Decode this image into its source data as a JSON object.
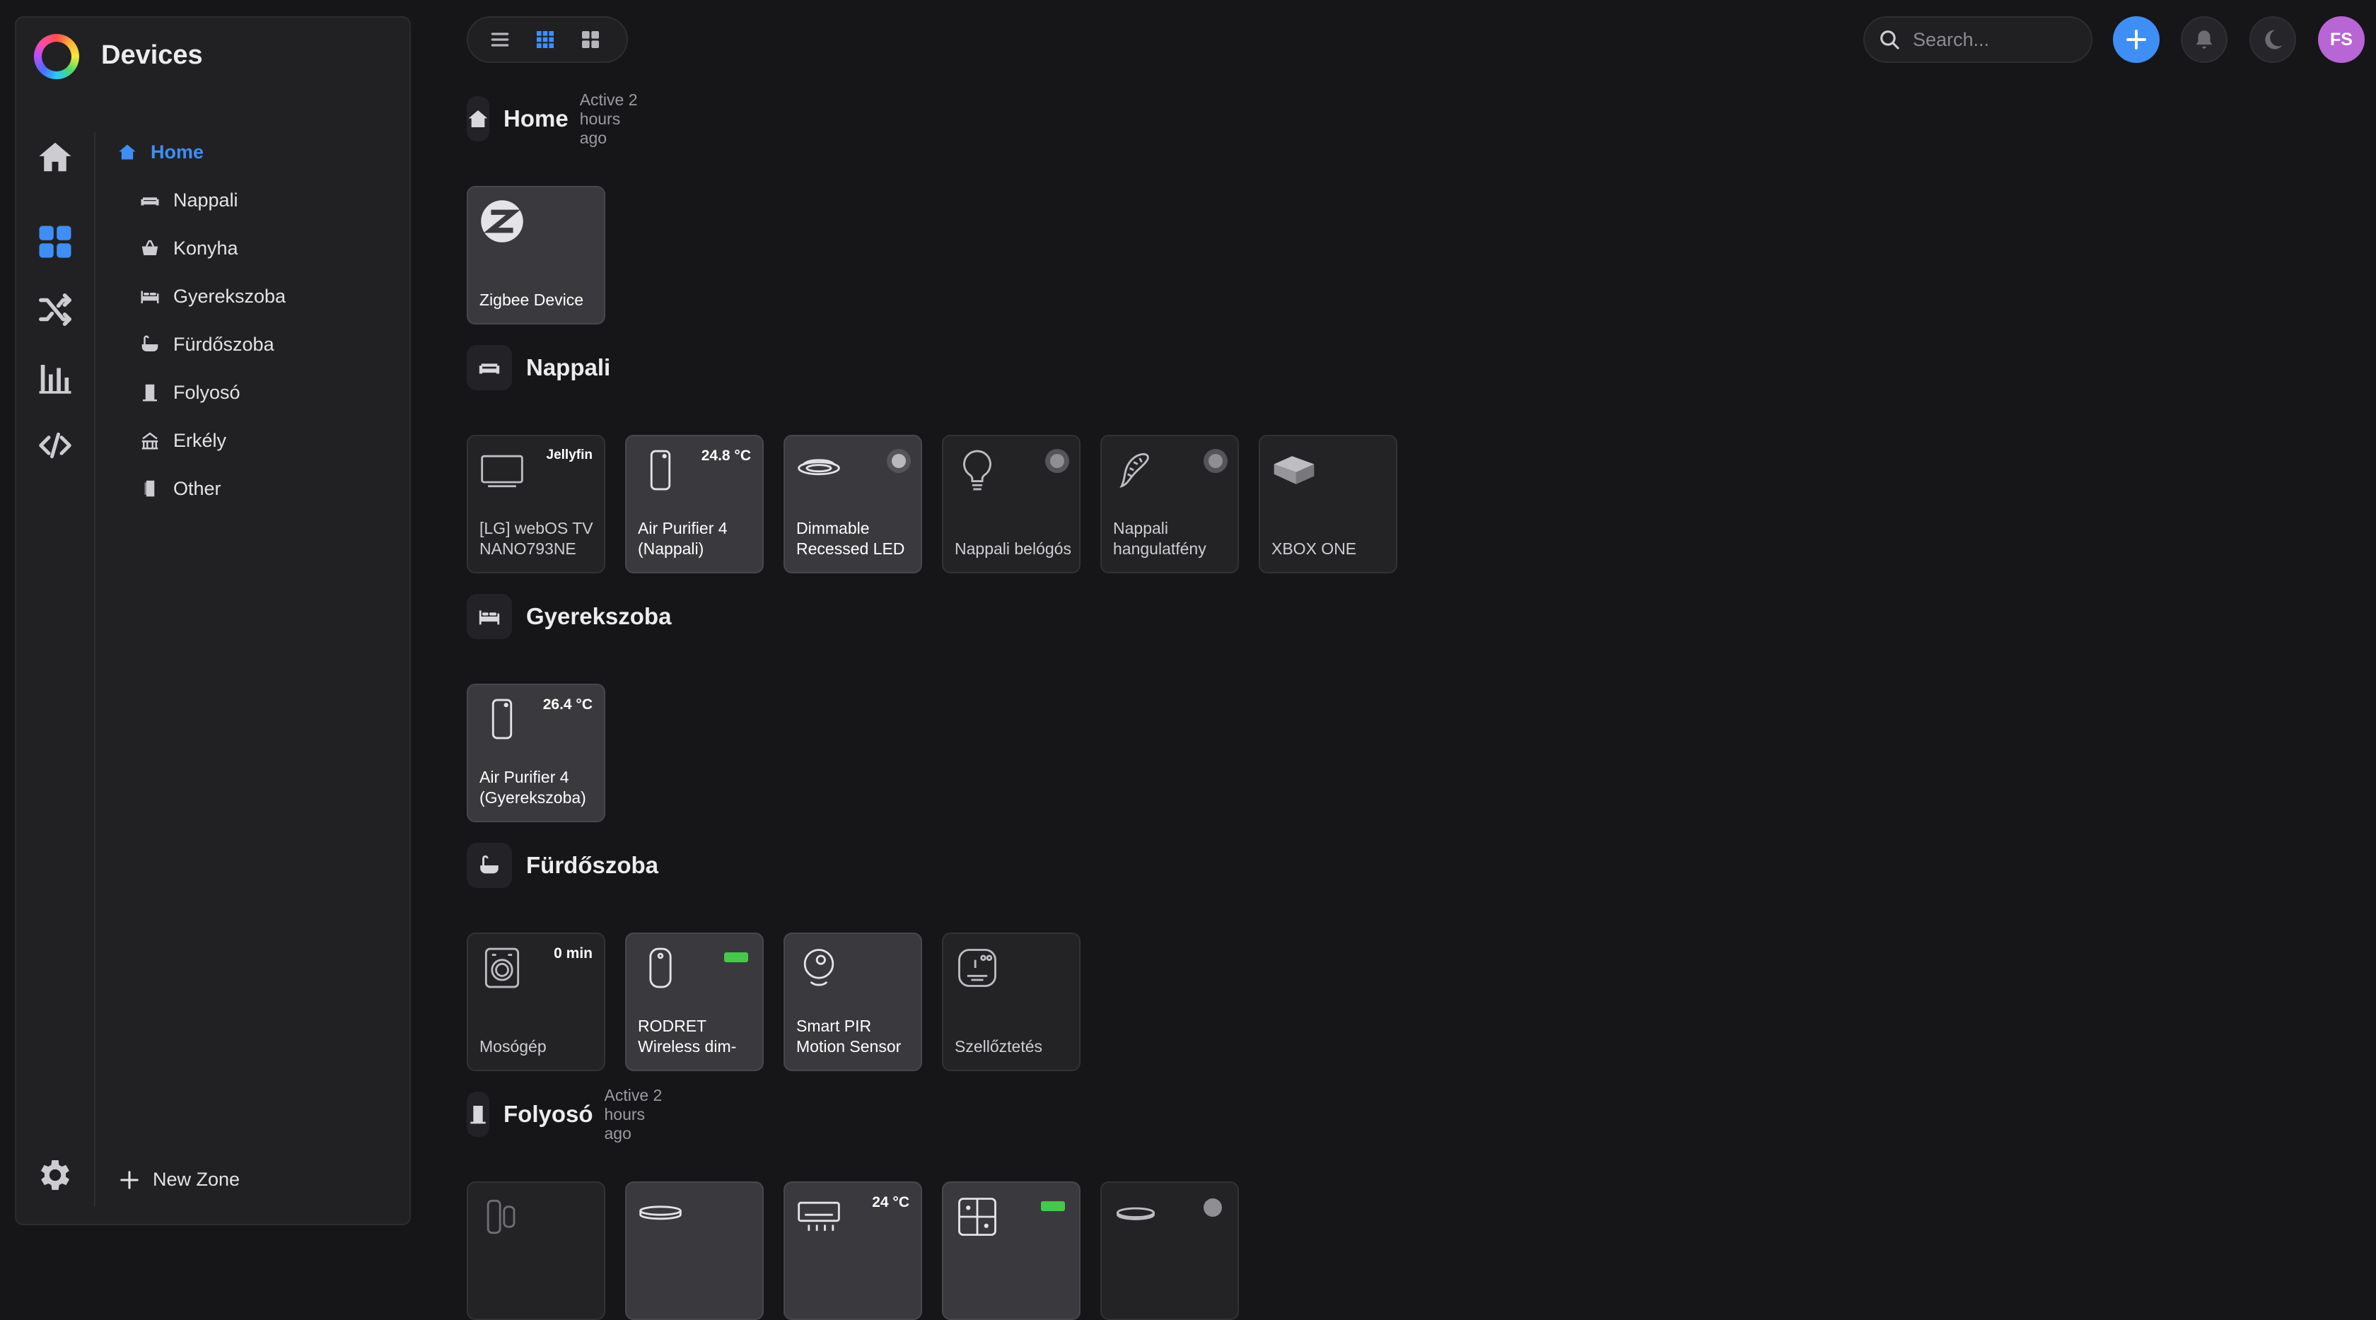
{
  "app": {
    "title": "Devices"
  },
  "sidebar": {
    "zones": [
      {
        "label": "Home",
        "icon": "home-icon",
        "active": true
      },
      {
        "label": "Nappali",
        "icon": "sofa-icon"
      },
      {
        "label": "Konyha",
        "icon": "basket-icon"
      },
      {
        "label": "Gyerekszoba",
        "icon": "bed-icon"
      },
      {
        "label": "Fürdőszoba",
        "icon": "bathtub-icon"
      },
      {
        "label": "Folyosó",
        "icon": "door-icon"
      },
      {
        "label": "Erkély",
        "icon": "balcony-icon"
      },
      {
        "label": "Other",
        "icon": "door-open-icon"
      }
    ],
    "new_zone_label": "New Zone"
  },
  "search": {
    "placeholder": "Search..."
  },
  "user": {
    "initials": "FS"
  },
  "colors": {
    "accent": "#3f8ef5",
    "avatar": "#b865d6",
    "battery": "#46c84a"
  },
  "zones": [
    {
      "title": "Home",
      "subtitle": "Active 2 hours ago",
      "icon": "home-icon",
      "devices": [
        {
          "label": "Zigbee Device",
          "icon": "zigbee-icon",
          "on": true
        }
      ]
    },
    {
      "title": "Nappali",
      "subtitle": "",
      "icon": "sofa-icon",
      "devices": [
        {
          "label": "[LG] webOS TV NANO793NE",
          "icon": "tv-icon",
          "status": "Jellyfin"
        },
        {
          "label": "Air Purifier 4 (Nappali)",
          "icon": "air-purifier-icon",
          "status": "24.8 °C",
          "on": true
        },
        {
          "label": "Dimmable Recessed LED",
          "icon": "recessed-light-icon",
          "on": true,
          "indicator": "toggle-on"
        },
        {
          "label": "Nappali belógós",
          "icon": "bulb-icon",
          "indicator": "toggle-off"
        },
        {
          "label": "Nappali hangulatfény",
          "icon": "led-strip-icon",
          "indicator": "toggle-off"
        },
        {
          "label": "XBOX ONE",
          "icon": "console-icon"
        }
      ]
    },
    {
      "title": "Gyerekszoba",
      "subtitle": "",
      "icon": "bed-icon",
      "devices": [
        {
          "label": "Air Purifier 4 (Gyerekszoba)",
          "icon": "air-purifier-icon",
          "status": "26.4 °C",
          "on": true
        }
      ]
    },
    {
      "title": "Fürdőszoba",
      "subtitle": "",
      "icon": "bathtub-icon",
      "devices": [
        {
          "label": "Mosógép",
          "icon": "washing-machine-icon",
          "status": "0 min"
        },
        {
          "label": "RODRET Wireless dim-",
          "icon": "remote-icon",
          "on": true,
          "indicator": "battery"
        },
        {
          "label": "Smart PIR Motion Sensor",
          "icon": "motion-sensor-icon",
          "on": true
        },
        {
          "label": "Szellőztetés",
          "icon": "switch-module-icon"
        }
      ]
    },
    {
      "title": "Folyosó",
      "subtitle": "Active 2 hours ago",
      "icon": "door-icon",
      "devices": [
        {
          "label": "",
          "icon": "door-sensor-icon"
        },
        {
          "label": "",
          "icon": "ceiling-light-icon",
          "on": true
        },
        {
          "label": "",
          "icon": "air-conditioner-icon",
          "status": "24 °C",
          "on": true
        },
        {
          "label": "",
          "icon": "wall-switch-icon",
          "on": true,
          "indicator": "battery"
        },
        {
          "label": "",
          "icon": "ceiling-lamp-icon",
          "indicator": "dot"
        }
      ]
    }
  ]
}
